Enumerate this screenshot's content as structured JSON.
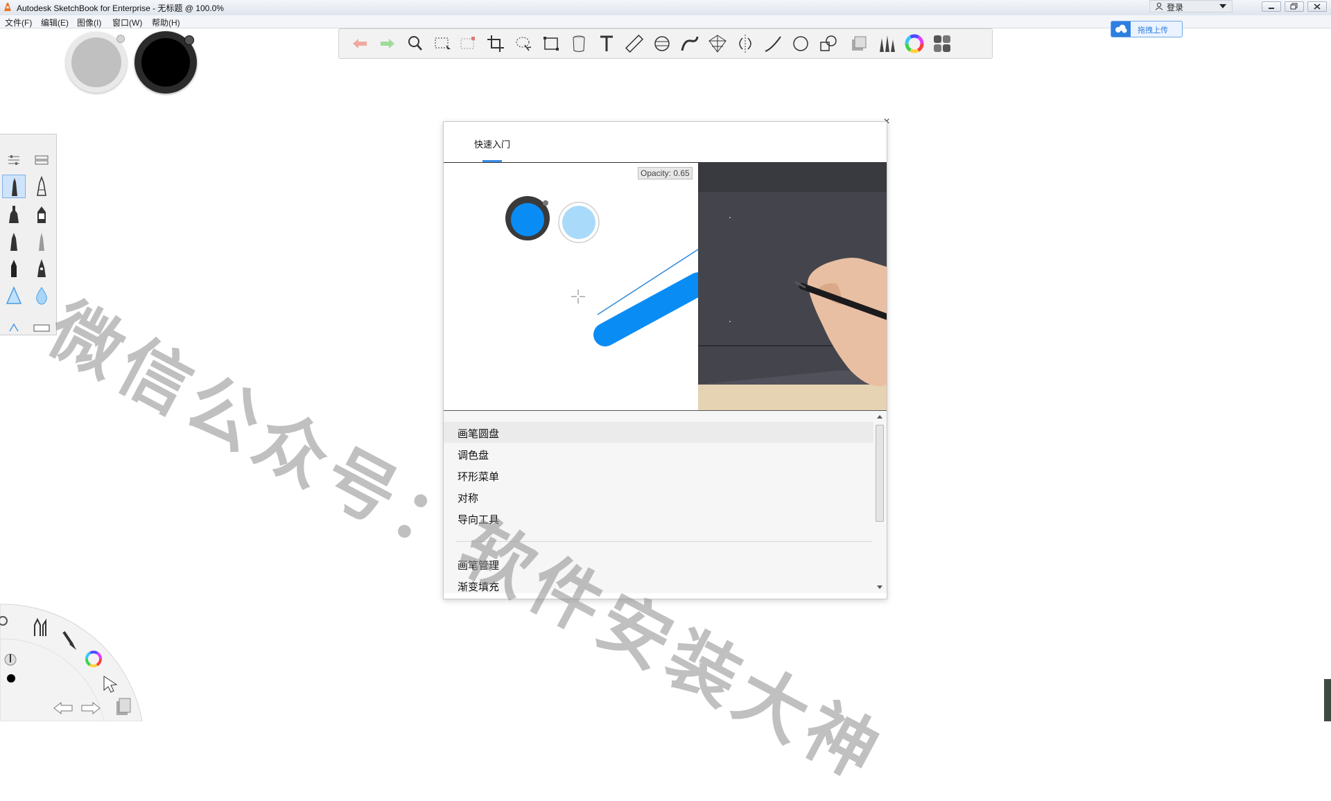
{
  "window": {
    "title": "Autodesk SketchBook for Enterprise - 无标题 @ 100.0%",
    "login_label": "登录",
    "buttons": [
      "minimize",
      "restore",
      "close"
    ]
  },
  "menubar": {
    "items": [
      "文件(F)",
      "编辑(E)",
      "图像(I)",
      "窗口(W)",
      "帮助(H)"
    ]
  },
  "upload": {
    "label": "拖拽上传"
  },
  "color_pucks": {
    "secondary": "#c0c0c0",
    "primary": "#000000"
  },
  "toolbar": {
    "tools": [
      "undo-icon",
      "redo-icon",
      "zoom-icon",
      "select-icon",
      "transform-select-icon",
      "crop-icon",
      "lasso-icon",
      "distort-icon",
      "fill-icon",
      "text-icon",
      "ruler-icon",
      "ellipse-icon",
      "french-curve-icon",
      "perspective-icon",
      "symmetry-icon",
      "line-icon",
      "circle-icon",
      "shape-icon",
      "layer-editor-icon",
      "brush-library-icon",
      "color-wheel-icon",
      "copic-library-icon"
    ]
  },
  "brush_palette": {
    "top_icons": [
      "brush-properties-icon",
      "palette-layout-icon"
    ],
    "brushes": [
      "pencil-icon",
      "ballpoint-icon",
      "marker-icon",
      "chisel-marker-icon",
      "ink-pen-icon",
      "soft-pencil-icon",
      "felt-pen-icon",
      "calligraphy-pen-icon",
      "airbrush-icon",
      "water-drop-icon",
      "small-airbrush-icon",
      "eraser-icon"
    ]
  },
  "dialog": {
    "tab": "快速入门",
    "opacity_label": "Opacity: 0.65",
    "topics": [
      "画笔圆盘",
      "调色盘",
      "环形菜单",
      "对称",
      "导向工具"
    ],
    "topics_group2": [
      "画笔管理",
      "渐变填充"
    ],
    "selected_topic": "画笔圆盘"
  },
  "watermark": "微信公众号：软件安装大神",
  "colors": {
    "accent_blue": "#0a8cf5",
    "light_blue": "#a9daf9",
    "dialog_tab_underline": "#3a8ee6"
  }
}
